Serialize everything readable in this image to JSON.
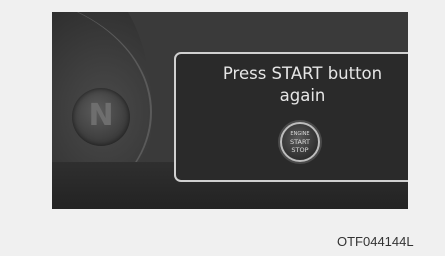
{
  "popup": {
    "message_line1": "Press START button",
    "message_line2": "again"
  },
  "start_button": {
    "line1": "ENGINE",
    "line2": "START",
    "line3": "STOP"
  },
  "gear_indicator": "N",
  "figure_code": "OTF044144L",
  "colors": {
    "cluster_background": "#3a3a3a",
    "popup_border": "#d0d0d0",
    "text": "#e6e6e6"
  }
}
